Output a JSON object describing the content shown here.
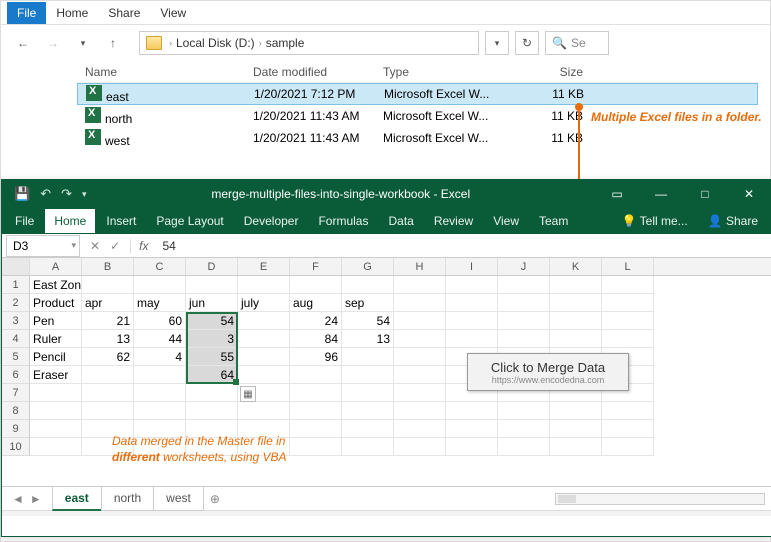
{
  "explorer": {
    "ribbon": [
      "File",
      "Home",
      "Share",
      "View"
    ],
    "breadcrumb": [
      "Local Disk (D:)",
      "sample"
    ],
    "search_placeholder": "Se",
    "columns": {
      "name": "Name",
      "date": "Date modified",
      "type": "Type",
      "size": "Size"
    },
    "files": [
      {
        "name": "east",
        "date": "1/20/2021 7:12 PM",
        "type": "Microsoft Excel W...",
        "size": "11 KB",
        "selected": true
      },
      {
        "name": "north",
        "date": "1/20/2021 11:43 AM",
        "type": "Microsoft Excel W...",
        "size": "11 KB",
        "selected": false
      },
      {
        "name": "west",
        "date": "1/20/2021 11:43 AM",
        "type": "Microsoft Excel W...",
        "size": "11 KB",
        "selected": false
      }
    ]
  },
  "annot1": "Multiple Excel files in a folder.",
  "annot2a": "Data merged in the Master file in",
  "annot2b": "different",
  "annot2c": " worksheets, using VBA",
  "excel": {
    "title": "merge-multiple-files-into-single-workbook - Excel",
    "ribbon": [
      "File",
      "Home",
      "Insert",
      "Page Layout",
      "Developer",
      "Formulas",
      "Data",
      "Review",
      "View",
      "Team"
    ],
    "tellme": "Tell me...",
    "share": "Share",
    "namebox": "D3",
    "formula": "54",
    "cols": [
      "A",
      "B",
      "C",
      "D",
      "E",
      "F",
      "G",
      "H",
      "I",
      "J",
      "K",
      "L"
    ],
    "rows": [
      {
        "n": "1",
        "c": [
          "East Zone",
          "",
          "",
          "",
          "",
          "",
          "",
          "",
          "",
          "",
          "",
          ""
        ]
      },
      {
        "n": "2",
        "c": [
          "Product",
          "apr",
          "may",
          "jun",
          "july",
          "aug",
          "sep",
          "",
          "",
          "",
          "",
          ""
        ]
      },
      {
        "n": "3",
        "c": [
          "Pen",
          "21",
          "60",
          "54",
          "",
          "24",
          "54",
          "",
          "",
          "",
          "",
          ""
        ]
      },
      {
        "n": "4",
        "c": [
          "Ruler",
          "13",
          "44",
          "3",
          "",
          "84",
          "13",
          "",
          "",
          "",
          "",
          ""
        ]
      },
      {
        "n": "5",
        "c": [
          "Pencil",
          "62",
          "4",
          "55",
          "",
          "96",
          "",
          "",
          "",
          "",
          "",
          ""
        ]
      },
      {
        "n": "6",
        "c": [
          "Eraser",
          "",
          "",
          "64",
          "",
          "",
          "",
          "",
          "",
          "",
          "",
          ""
        ]
      },
      {
        "n": "7",
        "c": [
          "",
          "",
          "",
          "",
          "",
          "",
          "",
          "",
          "",
          "",
          "",
          ""
        ]
      },
      {
        "n": "8",
        "c": [
          "",
          "",
          "",
          "",
          "",
          "",
          "",
          "",
          "",
          "",
          "",
          ""
        ]
      },
      {
        "n": "9",
        "c": [
          "",
          "",
          "",
          "",
          "",
          "",
          "",
          "",
          "",
          "",
          "",
          ""
        ]
      },
      {
        "n": "10",
        "c": [
          "",
          "",
          "",
          "",
          "",
          "",
          "",
          "",
          "",
          "",
          "",
          ""
        ]
      }
    ],
    "merge_btn": "Click to Merge Data",
    "merge_url": "https://www.encodedna.com",
    "sheets": [
      "east",
      "north",
      "west"
    ]
  }
}
